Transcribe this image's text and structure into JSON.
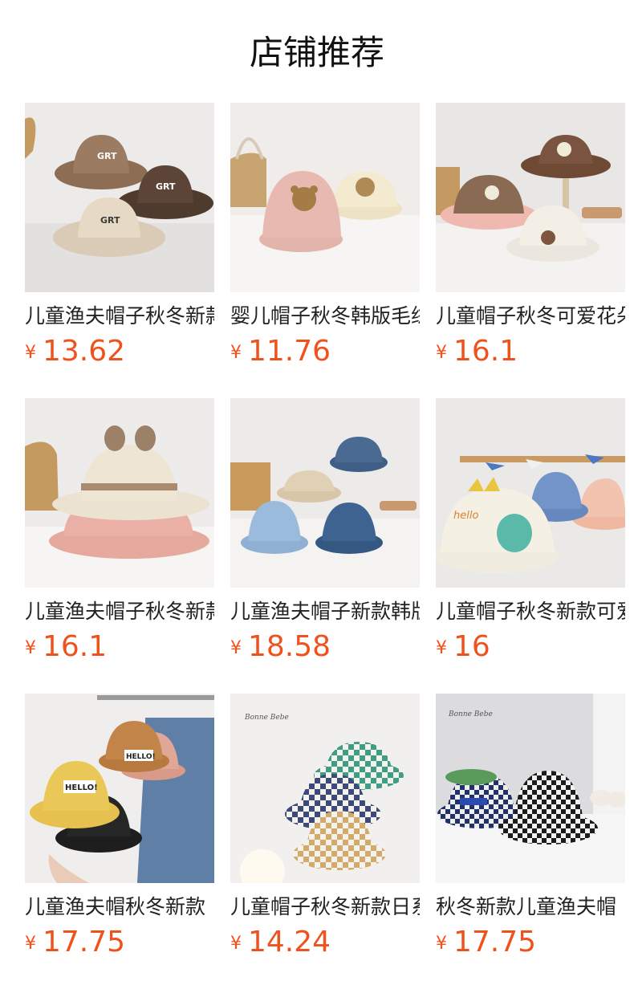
{
  "section": {
    "title": "店铺推荐"
  },
  "currency": "¥",
  "colors": {
    "price": "#f0521d",
    "text": "#222222"
  },
  "products": [
    {
      "name": "儿童渔夫帽子秋冬新款",
      "price": "13.62",
      "image": "brown-grt-bucket-hats",
      "label": "GRT"
    },
    {
      "name": "婴儿帽子秋冬韩版毛绒",
      "price": "11.76",
      "image": "pink-cream-bear-bucket-hats",
      "label": ""
    },
    {
      "name": "儿童帽子秋冬可爱花朵",
      "price": "16.1",
      "image": "flower-bucket-hats",
      "label": ""
    },
    {
      "name": "儿童渔夫帽子秋冬新款",
      "price": "16.1",
      "image": "bow-ear-bucket-hats",
      "label": ""
    },
    {
      "name": "儿童渔夫帽子新款韩版",
      "price": "18.58",
      "image": "denim-bucket-hats",
      "label": ""
    },
    {
      "name": "儿童帽子秋冬新款可爱",
      "price": "16",
      "image": "dinosaur-bucket-hats",
      "label": "hello"
    },
    {
      "name": "儿童渔夫帽秋冬新款",
      "price": "17.75",
      "image": "corduroy-hello-bucket-hats",
      "label": "HELLO!"
    },
    {
      "name": "儿童帽子秋冬新款日系",
      "price": "14.24",
      "image": "checkered-bucket-hats",
      "label": "Bonne Bebe"
    },
    {
      "name": "秋冬新款儿童渔夫帽",
      "price": "17.75",
      "image": "houndstooth-bucket-hats",
      "label": "Bonne Bebe"
    }
  ]
}
